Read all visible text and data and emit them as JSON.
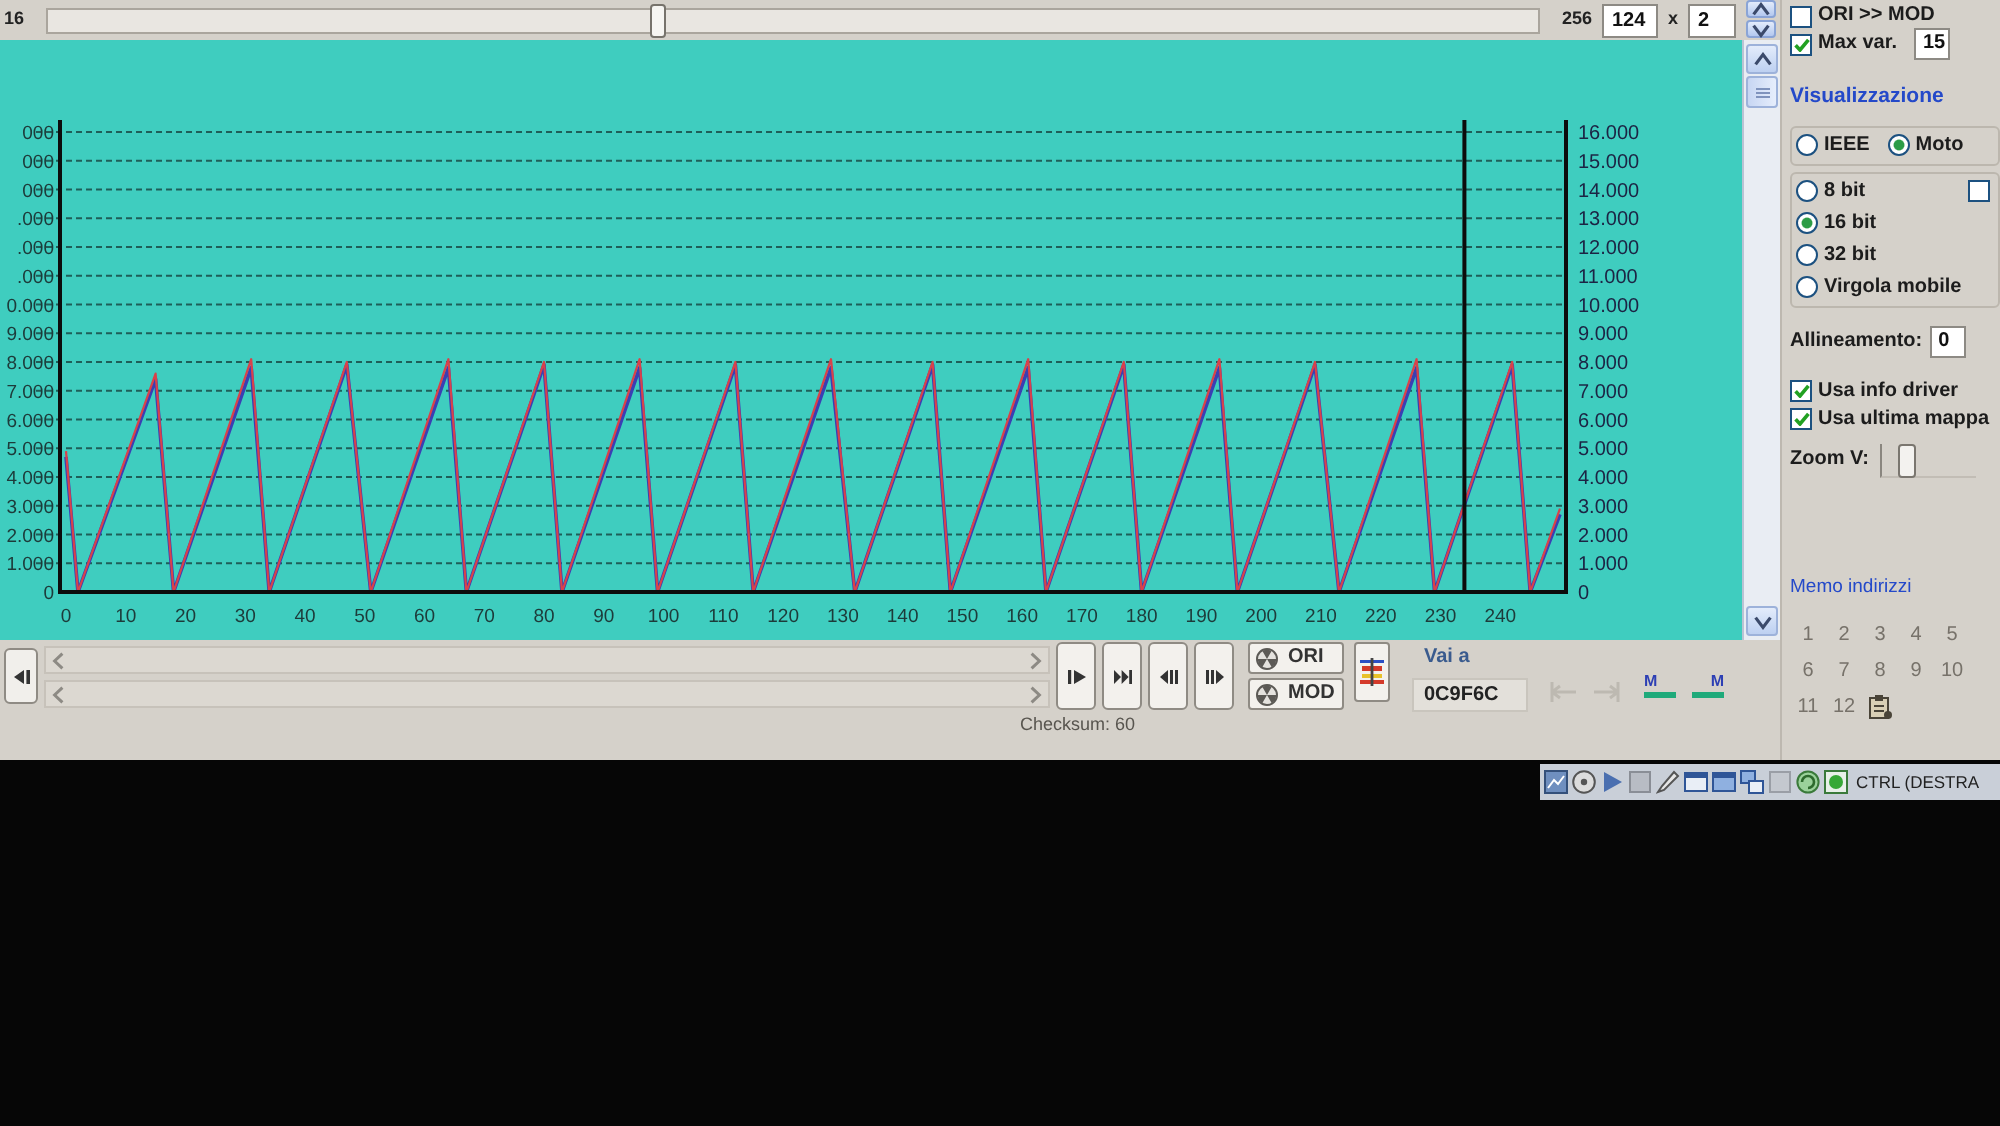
{
  "top_bar": {
    "label": "16",
    "slider": {
      "level": 0.41
    },
    "total": "256",
    "size_fields": [
      {
        "value": "124"
      },
      {
        "value": "2"
      }
    ],
    "separator": "x"
  },
  "options": [
    {
      "label": "ORI >> MOD",
      "checked": false
    },
    {
      "label": "Max var.",
      "checked": true,
      "value": "15"
    }
  ],
  "chart": {
    "left_axis_labels": [
      "000",
      "000",
      "000",
      ".000",
      ".000",
      ".000",
      "0.000",
      "9.000",
      "8.000",
      "7.000",
      "6.000",
      "5.000",
      "4.000",
      "3.000",
      "2.000",
      "1.000",
      "0"
    ],
    "chart_data": {
      "type": "line",
      "x": [
        0,
        2,
        15,
        18,
        31,
        34,
        47,
        51,
        64,
        67,
        80,
        83,
        96,
        99,
        112,
        115,
        128,
        132,
        145,
        148,
        161,
        164,
        177,
        180,
        193,
        196,
        209,
        213,
        226,
        229,
        242,
        245,
        250
      ],
      "series": [
        {
          "color": "#3a3fb4",
          "values": [
            4.7,
            0,
            7.4,
            0,
            7.8,
            0,
            7.9,
            0,
            7.8,
            0,
            7.9,
            0,
            7.8,
            0,
            7.9,
            0,
            7.8,
            0,
            7.9,
            0,
            7.8,
            0,
            7.9,
            0,
            7.8,
            0,
            7.9,
            0,
            7.8,
            0,
            7.9,
            0,
            2.7
          ]
        },
        {
          "color": "#d8424a",
          "values": [
            4.9,
            0,
            7.6,
            0,
            8.1,
            0,
            8.0,
            0,
            8.1,
            0,
            8.0,
            0,
            8.1,
            0,
            8.0,
            0,
            8.1,
            0,
            8.0,
            0,
            8.1,
            0,
            8.0,
            0,
            8.1,
            0,
            8.0,
            0,
            8.1,
            0,
            8.0,
            0,
            2.9
          ]
        }
      ],
      "xlim": [
        -1,
        251
      ],
      "ylim": [
        0,
        16
      ],
      "xticks": [
        0,
        10,
        20,
        30,
        40,
        50,
        60,
        70,
        80,
        90,
        100,
        110,
        120,
        130,
        140,
        150,
        160,
        170,
        180,
        190,
        200,
        210,
        220,
        230,
        240
      ],
      "yticks": [
        {
          "value": 0,
          "label": "0"
        },
        {
          "value": 1,
          "label": "1.000"
        },
        {
          "value": 2,
          "label": "2.000"
        },
        {
          "value": 3,
          "label": "3.000"
        },
        {
          "value": 4,
          "label": "4.000"
        },
        {
          "value": 5,
          "label": "5.000"
        },
        {
          "value": 6,
          "label": "6.000"
        },
        {
          "value": 7,
          "label": "7.000"
        },
        {
          "value": 8,
          "label": "8.000"
        },
        {
          "value": 9,
          "label": "9.000"
        },
        {
          "value": 10,
          "label": "10.000"
        },
        {
          "value": 11,
          "label": "11.000"
        },
        {
          "value": 12,
          "label": "12.000"
        },
        {
          "value": 13,
          "label": "13.000"
        },
        {
          "value": 14,
          "label": "14.000"
        },
        {
          "value": 15,
          "label": "15.000"
        },
        {
          "value": 16,
          "label": "16.000"
        }
      ],
      "grid": true,
      "ref_lines": [
        {
          "axis": "x",
          "value": 234,
          "color": "#0c0c0c"
        }
      ]
    }
  },
  "controls": {
    "data_buttons": [
      {
        "label": "ORI"
      },
      {
        "label": "MOD"
      }
    ],
    "goto": {
      "label": "Vai a",
      "value": "0C9F6C"
    },
    "jump_buttons": [
      {
        "disabled": true
      },
      {
        "disabled": true
      }
    ],
    "marker_buttons": [
      {
        "label": "M"
      },
      {
        "label": "M"
      }
    ],
    "checksum": "Checksum: 60"
  },
  "display": {
    "title": "Visualizzazione",
    "byte_order": [
      {
        "label": "IEEE",
        "selected": false
      },
      {
        "label": "Moto",
        "selected": true
      }
    ],
    "data_size": [
      {
        "label": "8 bit",
        "selected": false
      },
      {
        "label": "16 bit",
        "selected": true
      },
      {
        "label": "32 bit",
        "selected": false
      },
      {
        "label": "Virgola mobile",
        "selected": false
      }
    ],
    "side_checkbox": {
      "checked": false
    },
    "alignment": {
      "label": "Allineamento:",
      "value": "0"
    },
    "checks": [
      {
        "label": "Usa info driver",
        "checked": true
      },
      {
        "label": "Usa ultima mappa",
        "checked": true
      }
    ],
    "zoom": {
      "label": "Zoom V:",
      "level": 0.2
    }
  },
  "address_memo": {
    "title": "Memo indirizzi",
    "slots": [
      {
        "label": "1",
        "disabled": true
      },
      {
        "label": "2",
        "disabled": true
      },
      {
        "label": "3",
        "disabled": true
      },
      {
        "label": "4",
        "disabled": true
      },
      {
        "label": "5",
        "disabled": true
      },
      {
        "label": "6",
        "disabled": true
      },
      {
        "label": "7",
        "disabled": true
      },
      {
        "label": "8",
        "disabled": true
      },
      {
        "label": "9",
        "disabled": true
      },
      {
        "label": "10",
        "disabled": true
      },
      {
        "label": "11",
        "disabled": true
      },
      {
        "label": "12",
        "disabled": true
      }
    ]
  },
  "status_bar": {
    "text": "CTRL (DESTRA"
  }
}
